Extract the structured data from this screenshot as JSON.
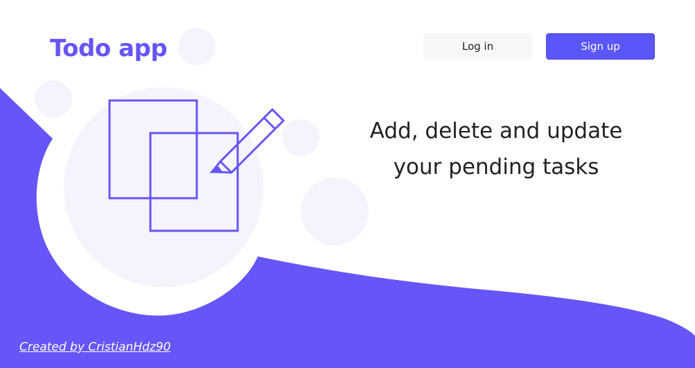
{
  "header": {
    "brand": "Todo app",
    "login_label": "Log in",
    "signup_label": "Sign up"
  },
  "hero": {
    "line1": "Add, delete and update",
    "line2": "your pending tasks"
  },
  "footer": {
    "credit": "Created by CristianHdz90"
  },
  "colors": {
    "accent": "#6655f7",
    "bubble": "#f5f4fd",
    "signup_bg": "#5a56f7",
    "login_bg": "#f6f7f9"
  },
  "icons": {
    "hero_illustration": "notes-pencil-icon"
  }
}
